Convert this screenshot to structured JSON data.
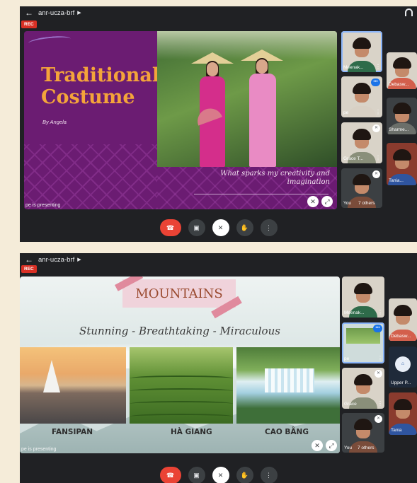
{
  "shots": [
    {
      "meeting_code": "anr-ucza-brf",
      "rec_label": "REC",
      "presenting_text": "pe is presenting",
      "slide": {
        "title": "Traditional Costume",
        "byline": "By Angela",
        "quote": "What sparks my creativity and imagination"
      },
      "participants": [
        "Meenak...",
        "Debasw...",
        "pe",
        "Sharme...",
        "Grace T...",
        "Tania..."
      ],
      "self_label": "You",
      "others_label": "7 others"
    },
    {
      "meeting_code": "anr-ucza-brf",
      "rec_label": "REC",
      "presenting_text": "pe is presenting",
      "slide": {
        "title": "MOUNTAINS",
        "subtitle": "Stunning - Breathtaking - Miraculous",
        "captions": [
          "FANSIPAN",
          "HÀ GIANG",
          "CAO BẰNG"
        ]
      },
      "participants": [
        "Meenak...",
        "Debasw...",
        "pe",
        "Upper P...",
        "Grace",
        "Tania"
      ],
      "self_label": "You",
      "others_label": "7 others"
    }
  ],
  "icons": {
    "back": "arrow-left-icon",
    "end_call": "phone-hangup-icon",
    "camera": "camera-icon",
    "mic": "mic-off-icon",
    "hand": "raise-hand-icon",
    "more": "more-vertical-icon"
  },
  "colors": {
    "end_call": "#ea4335",
    "rec": "#d93025",
    "slide1_bg": "#6b1c72",
    "slide1_title": "#f4a43a",
    "slide2_title": "#9a4a2f"
  }
}
